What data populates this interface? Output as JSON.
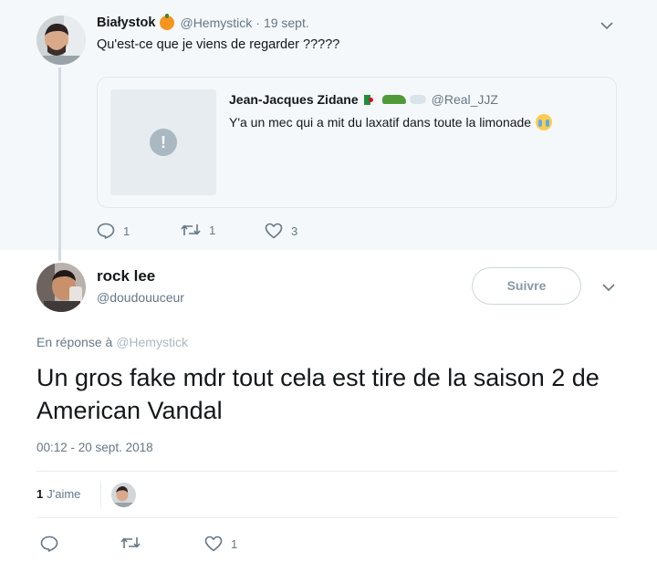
{
  "parent_tweet": {
    "author_name": "Białystok",
    "author_handle": "@Hemystick",
    "separator": "·",
    "date": "19 sept.",
    "text": "Qu'est-ce que je viens de regarder ?????",
    "quoted_tweet": {
      "author_name": "Jean-Jacques Zidane",
      "author_handle": "@Real_JJZ",
      "text": "Y'a un mec qui a mit du laxatif dans toute la limonade",
      "media_status_icon": "exclamation-icon"
    },
    "actions": {
      "replies": "1",
      "retweets": "1",
      "likes": "3"
    }
  },
  "main_tweet": {
    "author_name": "rock lee",
    "author_handle": "@doudouuceur",
    "follow_label": "Suivre",
    "reply_prefix": "En réponse à",
    "reply_mention": "@Hemystick",
    "text": "Un gros fake mdr tout cela est tire de la saison 2 de American Vandal",
    "timestamp": "00:12 - 20 sept. 2018",
    "likes_count": "1",
    "likes_label": "J'aime",
    "actions": {
      "likes": "1"
    }
  },
  "colors": {
    "secondary_text": "#657786",
    "parent_background": "#f5f8fa",
    "border": "#e1e8ed",
    "orange_emoji": "#f7941e"
  },
  "icons": [
    "reply-icon",
    "retweet-icon",
    "heart-icon",
    "chevron-down-icon",
    "exclamation-icon"
  ]
}
